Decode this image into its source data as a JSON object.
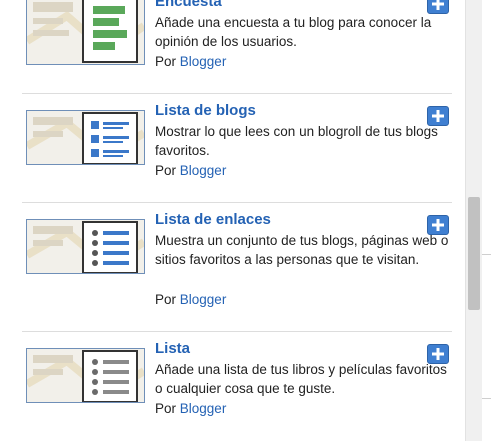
{
  "gadgets": [
    {
      "title": "Encuesta",
      "description": "Añade una encuesta a tu blog para conocer la opinión de los usuarios.",
      "by_prefix": "Por",
      "author": "Blogger",
      "icon": "poll-icon"
    },
    {
      "title": "Lista de blogs",
      "description": "Mostrar lo que lees con un blogroll de tus blogs favoritos.",
      "by_prefix": "Por",
      "author": "Blogger",
      "icon": "blog-list-icon"
    },
    {
      "title": "Lista de enlaces",
      "description": "Muestra un conjunto de tus blogs, páginas web o sitios favoritos a las personas que te visitan.",
      "by_prefix": "Por",
      "author": "Blogger",
      "icon": "link-list-icon"
    },
    {
      "title": "Lista",
      "description": "Añade una lista de tus libros y películas favoritos o cualquier cosa que te guste.",
      "by_prefix": "Por",
      "author": "Blogger",
      "icon": "list-icon"
    }
  ],
  "colors": {
    "link": "#2462b4",
    "add_button": "#3f7fd1",
    "poll_bars": "#5aa85a",
    "list_bullets": "#3b78c9"
  }
}
